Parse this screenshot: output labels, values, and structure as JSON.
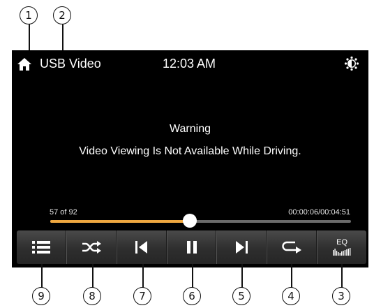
{
  "status_bar": {
    "source": "USB Video",
    "time": "12:03 AM"
  },
  "warning": {
    "title": "Warning",
    "message": "Video Viewing Is Not Available While Driving."
  },
  "progress": {
    "track_count": "57 of 92",
    "time_readout": "00:00:06/00:04:51",
    "fraction": 0.465
  },
  "controls": {
    "eq_label": "EQ"
  },
  "callouts": [
    "1",
    "2",
    "3",
    "4",
    "5",
    "6",
    "7",
    "8",
    "9"
  ],
  "colors": {
    "accent": "#f0a840",
    "screen_bg": "#000000"
  }
}
